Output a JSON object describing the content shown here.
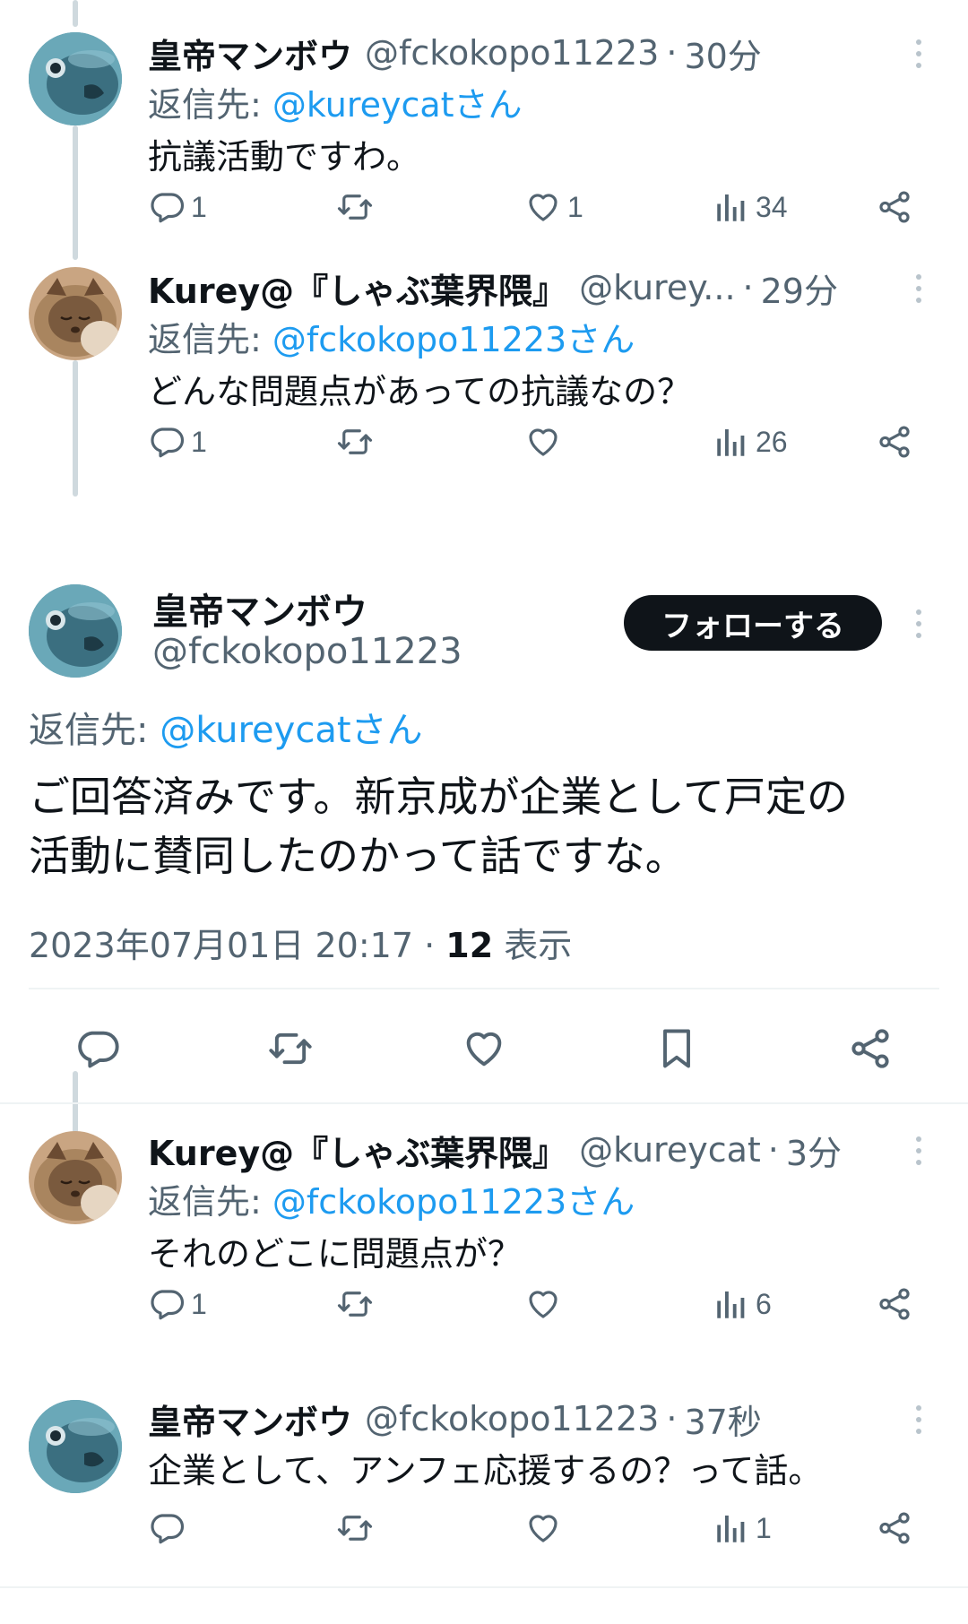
{
  "tweets": [
    {
      "name": "皇帝マンボウ",
      "handle": "@fckokopo11223",
      "sep": "·",
      "time": "30分",
      "reply_label": "返信先:",
      "reply_mention": "@kureycatさん",
      "text": "抗議活動ですわ。",
      "reply_count": "1",
      "like_count": "1",
      "view_count": "34"
    },
    {
      "name": "Kurey@『しゃぶ葉界隈』",
      "handle": "@kurey...",
      "sep": "·",
      "time": "29分",
      "reply_label": "返信先:",
      "reply_mention": "@fckokopo11223さん",
      "text": "どんな問題点があっての抗議なの？",
      "reply_count": "1",
      "like_count": "",
      "view_count": "26"
    },
    {
      "name": "Kurey@『しゃぶ葉界隈』",
      "handle": "@kureycat",
      "sep": "·",
      "time": "3分",
      "reply_label": "返信先:",
      "reply_mention": "@fckokopo11223さん",
      "text": "それのどこに問題点が？",
      "reply_count": "1",
      "like_count": "",
      "view_count": "6"
    },
    {
      "name": "皇帝マンボウ",
      "handle": "@fckokopo11223",
      "sep": "·",
      "time": "37秒",
      "text": "企業として、アンフェ応援するの？って話。",
      "reply_count": "",
      "like_count": "",
      "view_count": "1"
    }
  ],
  "main_tweet": {
    "name": "皇帝マンボウ",
    "handle": "@fckokopo11223",
    "follow_label": "フォローする",
    "reply_label": "返信先:",
    "reply_mention": "@kureycatさん",
    "text_line1": "ご回答済みです。新京成が企業として戸定の",
    "text_line2": "活動に賛同したのかって話ですな。",
    "timestamp": "2023年07月01日 20:17",
    "sep": "·",
    "views": "12",
    "views_label": "表示"
  },
  "colors": {
    "link": "#1d9bf0",
    "secondary_text": "#536471",
    "primary_text": "#0f1419",
    "thread_line": "#cfd9de"
  },
  "icons": {
    "reply": "reply-icon",
    "retweet": "retweet-icon",
    "like": "heart-icon",
    "views": "views-icon",
    "share": "share-icon",
    "bookmark": "bookmark-icon",
    "more": "more-icon"
  }
}
